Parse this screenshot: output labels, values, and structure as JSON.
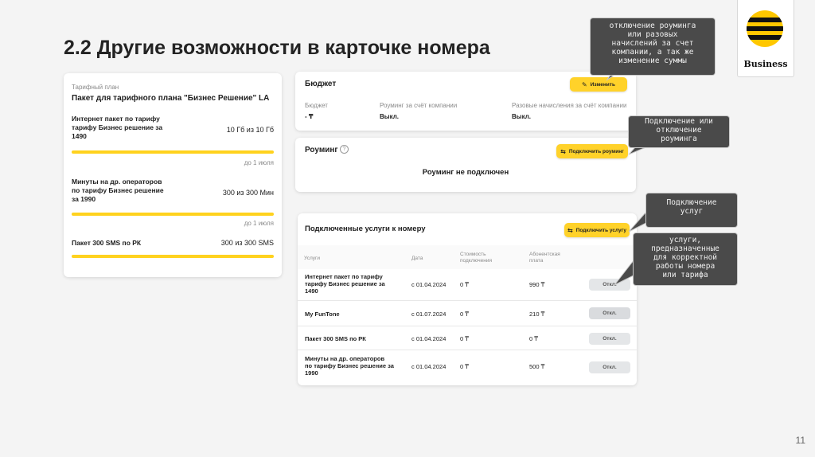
{
  "slide": {
    "title": "2.2 Другие возможности в карточке номера",
    "page_number": "11"
  },
  "logo": {
    "text": "Business",
    "colors": {
      "yellow": "#ffc700",
      "black": "#111111"
    }
  },
  "tariff_card": {
    "label": "Тарифный план",
    "name": "Пакет для тарифного плана \"Бизнес Решение\" LA",
    "items": [
      {
        "name_lines": [
          "Интернет пакет по тарифу",
          "тарифу Бизнес решение за",
          "1490"
        ],
        "value": "10 Гб из 10 Гб",
        "until": "до 1 июля",
        "fill": 1.0
      },
      {
        "name_lines": [
          "Минуты на др. операторов",
          "по тарифу Бизнес решение",
          "за 1990"
        ],
        "value": "300 из 300 Мин",
        "until": "до 1 июля",
        "fill": 1.0
      },
      {
        "name_lines": [
          "Пакет 300 SMS по РК"
        ],
        "value": "300 из 300 SMS",
        "until": "",
        "fill": 1.0
      }
    ]
  },
  "budget_card": {
    "title": "Бюджет",
    "button": "Изменить",
    "cols": [
      {
        "label": "Бюджет",
        "value": "- ₸"
      },
      {
        "label": "Роуминг за счёт компании",
        "value": "Выкл."
      },
      {
        "label": "Разовые начисления за счёт компании",
        "value": "Выкл."
      }
    ]
  },
  "roaming_card": {
    "title": "Роуминг",
    "button": "Подключить роуминг",
    "status": "Роуминг не подключен"
  },
  "services_card": {
    "title": "Подключенные услуги к номеру",
    "button": "Подключить услугу",
    "headers": [
      "Услуги",
      "Дата",
      "Стоимость подключения",
      "Абонентская плата"
    ],
    "rows": [
      {
        "name_lines": [
          "Интернет пакет по тарифу",
          "тарифу Бизнес решение за",
          "1490"
        ],
        "date": "с 01.04.2024",
        "cost": "0 ₸",
        "fee": "990 ₸",
        "action": "Откл."
      },
      {
        "name_lines": [
          "My FunTone"
        ],
        "date": "с 01.07.2024",
        "cost": "0 ₸",
        "fee": "210 ₸",
        "action": "Откл."
      },
      {
        "name_lines": [
          "Пакет 300 SMS по РК"
        ],
        "date": "с 01.04.2024",
        "cost": "0 ₸",
        "fee": "0 ₸",
        "action": "Откл."
      },
      {
        "name_lines": [
          "Минуты на др. операторов",
          "по тарифу Бизнес решение за",
          "1990"
        ],
        "date": "с 01.04.2024",
        "cost": "0 ₸",
        "fee": "500 ₸",
        "action": "Откл."
      }
    ]
  },
  "callouts": [
    {
      "lines": [
        "отключение роуминга",
        "или разовых",
        "начислений за счет",
        "компании, а так же",
        "изменение суммы"
      ]
    },
    {
      "lines": [
        "Подключение или",
        "отключение",
        "роуминга"
      ]
    },
    {
      "lines": [
        "Подключение",
        "услуг"
      ]
    },
    {
      "lines": [
        "услуги,",
        "предназначенные",
        "для корректной",
        "работы номера",
        "или тарифа"
      ]
    }
  ]
}
